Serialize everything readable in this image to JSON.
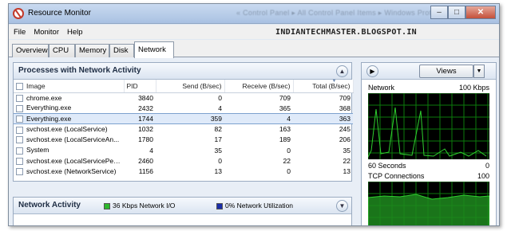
{
  "window": {
    "title": "Resource Monitor",
    "breadcrumb": "« Control Panel ▸ All Control Panel Items ▸ Windows Protect..."
  },
  "watermark": "INDIANTECHMASTER.BLOGSPOT.IN",
  "menu": [
    "File",
    "Monitor",
    "Help"
  ],
  "tabs": [
    "Overview",
    "CPU",
    "Memory",
    "Disk",
    "Network"
  ],
  "active_tab": "Network",
  "processes_panel": {
    "title": "Processes with Network Activity",
    "columns": {
      "image": "Image",
      "pid": "PID",
      "send": "Send (B/sec)",
      "receive": "Receive (B/sec)",
      "total": "Total (B/sec)"
    },
    "rows": [
      {
        "image": "chrome.exe",
        "pid": "3840",
        "send": "0",
        "receive": "709",
        "total": "709"
      },
      {
        "image": "Everything.exe",
        "pid": "2432",
        "send": "4",
        "receive": "365",
        "total": "368"
      },
      {
        "image": "Everything.exe",
        "pid": "1744",
        "send": "359",
        "receive": "4",
        "total": "363"
      },
      {
        "image": "svchost.exe (LocalService)",
        "pid": "1032",
        "send": "82",
        "receive": "163",
        "total": "245"
      },
      {
        "image": "svchost.exe (LocalServiceAn...",
        "pid": "1780",
        "send": "17",
        "receive": "189",
        "total": "206"
      },
      {
        "image": "System",
        "pid": "4",
        "send": "35",
        "receive": "0",
        "total": "35"
      },
      {
        "image": "svchost.exe (LocalServicePee...",
        "pid": "2460",
        "send": "0",
        "receive": "22",
        "total": "22"
      },
      {
        "image": "svchost.exe (NetworkService)",
        "pid": "1156",
        "send": "13",
        "receive": "0",
        "total": "13"
      }
    ],
    "selected_row": 2
  },
  "network_activity": {
    "title": "Network Activity",
    "io_label": "36 Kbps Network I/O",
    "util_label": "0% Network Utilization",
    "io_color": "#2db82d",
    "util_color": "#1a2ea8"
  },
  "right_panel": {
    "views_label": "Views",
    "network_graph": {
      "label": "Network",
      "max": "100 Kbps",
      "time": "60 Seconds",
      "min": "0"
    },
    "tcp_graph": {
      "label": "TCP Connections",
      "max": "100"
    }
  },
  "colors": {
    "graph_bg": "#000000",
    "graph_grid": "#0b7a0b",
    "graph_line": "#2fd12f",
    "graph_fill": "#1f8a1f",
    "selection": "#dfeaf9"
  }
}
